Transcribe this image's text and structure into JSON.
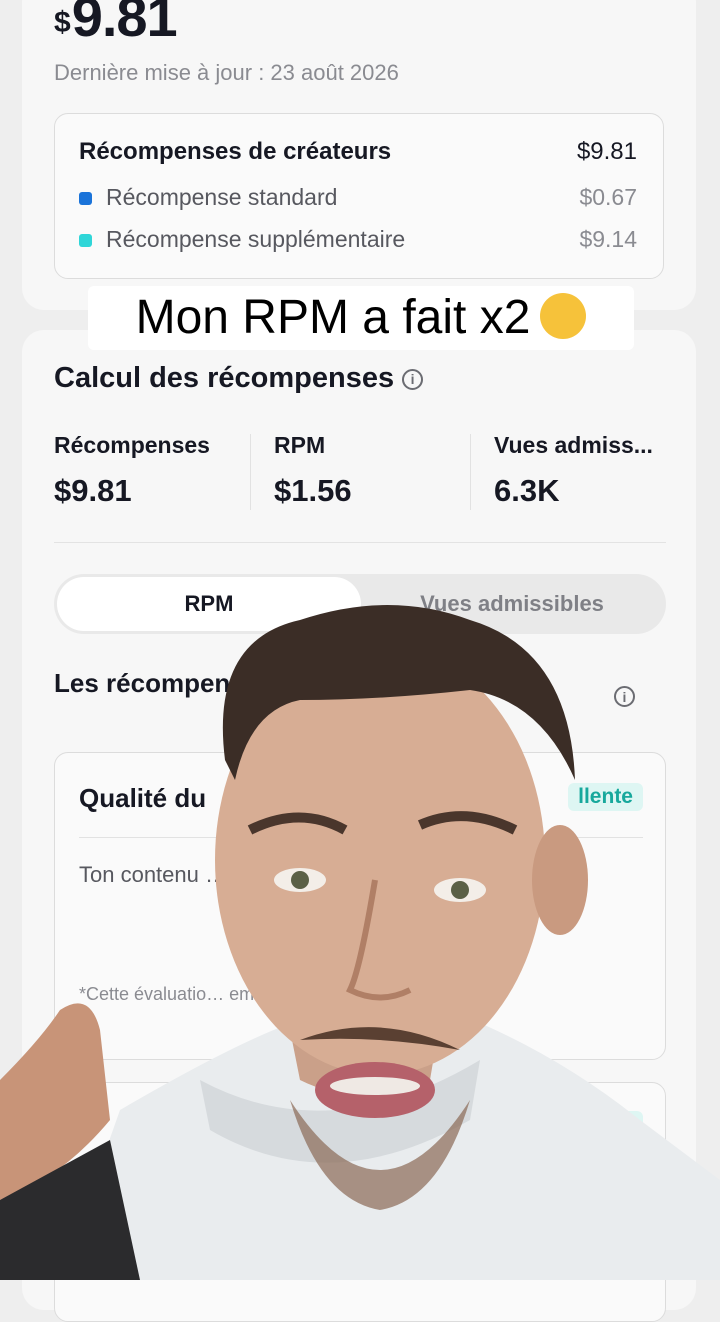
{
  "rewards": {
    "currency_symbol": "$",
    "total_amount": "9.81",
    "last_updated": "Dernière mise à jour : 23 août 2026",
    "breakdown": {
      "title": "Récompenses de créateurs",
      "total": "$9.81",
      "items": [
        {
          "label": "Récompense standard",
          "value": "$0.67",
          "color": "#1a73d9"
        },
        {
          "label": "Récompense supplémentaire",
          "value": "$9.14",
          "color": "#2fd6d8"
        }
      ]
    }
  },
  "caption": "Mon RPM a fait x2",
  "calc": {
    "title": "Calcul des récompenses",
    "metrics": [
      {
        "label": "Récompenses",
        "value": "$9.81"
      },
      {
        "label": "RPM",
        "value": "$1.56"
      },
      {
        "label": "Vues admiss...",
        "value": "6.3K"
      }
    ],
    "tabs": [
      "RPM",
      "Vues admissibles"
    ],
    "description": "Les récompen… ont augmenté to…",
    "quality": {
      "title": "Qualité du",
      "badge": "llente",
      "text": "Ton contenu … Continue de … us de récompense…",
      "note": "*Cette évaluatio… ement. La précision peut v…"
    },
    "second_badge": "te"
  },
  "icons": {
    "info": "info-icon",
    "emoji": "screaming-face-emoji"
  }
}
